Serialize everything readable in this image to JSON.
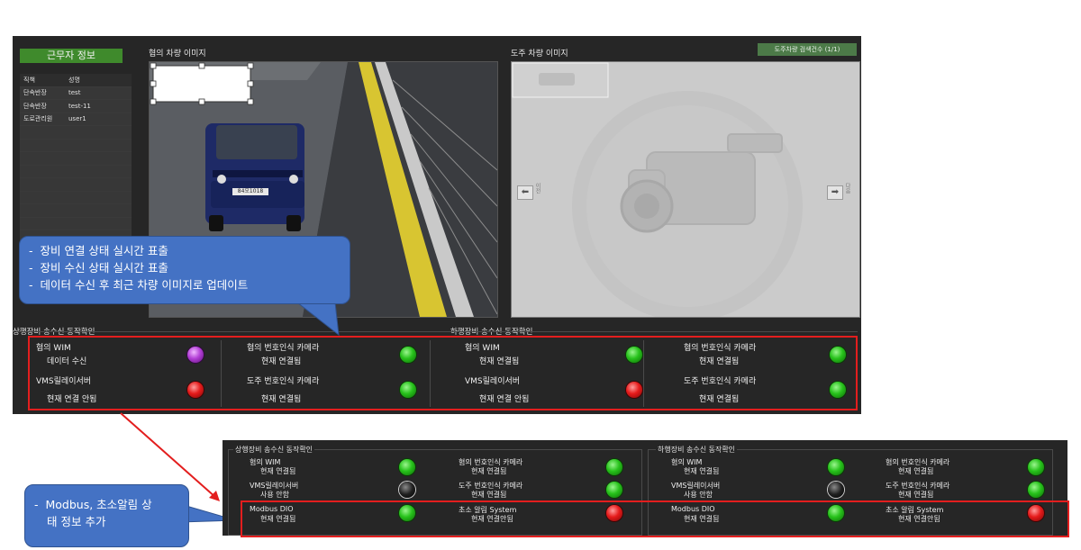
{
  "staff": {
    "header": "근무자 정보",
    "columns": [
      "직책",
      "성명"
    ],
    "rows": [
      {
        "role": "단속반장",
        "name": "test"
      },
      {
        "role": "단속반장",
        "name": "test-11"
      },
      {
        "role": "도로관리원",
        "name": "user1"
      }
    ]
  },
  "images": {
    "suspect_title": "혐의 차량 이미지",
    "escape_title": "도주 차량 이미지",
    "search_count": "도주차량 검색건수 (1/1)",
    "plate_text": "84오1018",
    "prev_label": "이전",
    "next_label": "다음"
  },
  "status_top": {
    "up_title": "상행장비 송수신 동작확인",
    "down_title": "하행장비 송수신 동작확인",
    "up": [
      {
        "name": "혐의 WIM",
        "status": "데이터 수신",
        "color": "purple"
      },
      {
        "name": "혐의 번호인식 카메라",
        "status": "현재 연결됨",
        "color": "green"
      },
      {
        "name": "VMS릴레이서버",
        "status": "현재 연결 안됨",
        "color": "red"
      },
      {
        "name": "도주 번호인식 카메라",
        "status": "현재 연결됨",
        "color": "green"
      }
    ],
    "down": [
      {
        "name": "혐의 WIM",
        "status": "현재 연결됨",
        "color": "green"
      },
      {
        "name": "혐의 번호인식 카메라",
        "status": "현재 연결됨",
        "color": "green"
      },
      {
        "name": "VMS릴레이서버",
        "status": "현재 연결 안됨",
        "color": "red"
      },
      {
        "name": "도주 번호인식 카메라",
        "status": "현재 연결됨",
        "color": "green"
      }
    ]
  },
  "status_bottom": {
    "up_title": "상행장비 송수신 동작확인",
    "down_title": "하행장비 송수신 동작확인",
    "up": [
      {
        "name": "혐의 WIM",
        "status": "현재 연결됨",
        "color": "green"
      },
      {
        "name": "혐의 번호인식 카메라",
        "status": "현재 연결됨",
        "color": "green"
      },
      {
        "name": "VMS릴레이서버",
        "status": "사용 안함",
        "color": "black"
      },
      {
        "name": "도주 번호인식 카메라",
        "status": "현재 연결됨",
        "color": "green"
      },
      {
        "name": "Modbus DIO",
        "status": "현재 연결됨",
        "color": "green"
      },
      {
        "name": "초소 알림 System",
        "status": "현재 연결안됨",
        "color": "red"
      }
    ],
    "down": [
      {
        "name": "혐의 WIM",
        "status": "현재 연결됨",
        "color": "green"
      },
      {
        "name": "혐의 번호인식 카메라",
        "status": "현재 연결됨",
        "color": "green"
      },
      {
        "name": "VMS릴레이서버",
        "status": "사용 안함",
        "color": "black"
      },
      {
        "name": "도주 번호인식 카메라",
        "status": "현재 연결됨",
        "color": "green"
      },
      {
        "name": "Modbus DIO",
        "status": "현재 연결됨",
        "color": "green"
      },
      {
        "name": "초소 알림 System",
        "status": "현재 연결안됨",
        "color": "red"
      }
    ]
  },
  "callout1": {
    "bullet": "-",
    "lines": [
      "장비 연결 상태 실시간 표출",
      "장비 수신 상태 실시간 표출",
      "데이터 수신 후 최근 차량 이미지로 업데이트"
    ]
  },
  "callout2": {
    "bullet": "-",
    "line1": "Modbus, 초소알림 상",
    "line2": "태 정보 추가"
  },
  "colors": {
    "accent_red": "#e31e1e",
    "callout_blue": "#4472c4",
    "header_green": "#3f8a2c"
  }
}
